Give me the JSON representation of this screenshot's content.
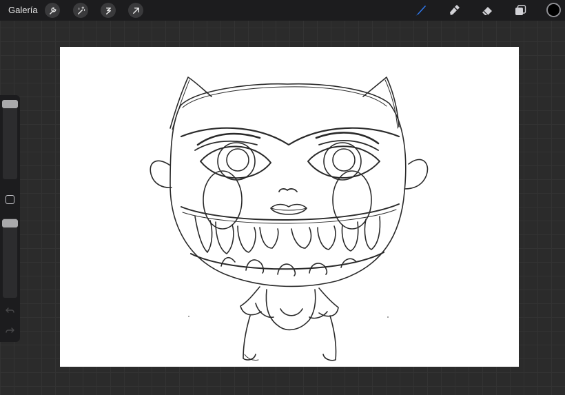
{
  "topbar": {
    "gallery_label": "Galería",
    "left_tools": [
      "wrench-icon",
      "magic-wand-icon",
      "selection-icon",
      "transform-arrow-icon"
    ],
    "right_tools": [
      "brush-icon",
      "smudge-icon",
      "eraser-icon",
      "layers-icon"
    ],
    "active_tool": "brush",
    "active_color": "#000000",
    "accent_color": "#2f7bf5"
  },
  "sidebar": {
    "brush_size_level": 0.95,
    "opacity_level": 0.95,
    "icons": [
      "modify-square-icon",
      "undo-icon",
      "redo-icon"
    ]
  },
  "canvas": {
    "background": "#ffffff",
    "artwork": "pencil-sketch-character"
  }
}
